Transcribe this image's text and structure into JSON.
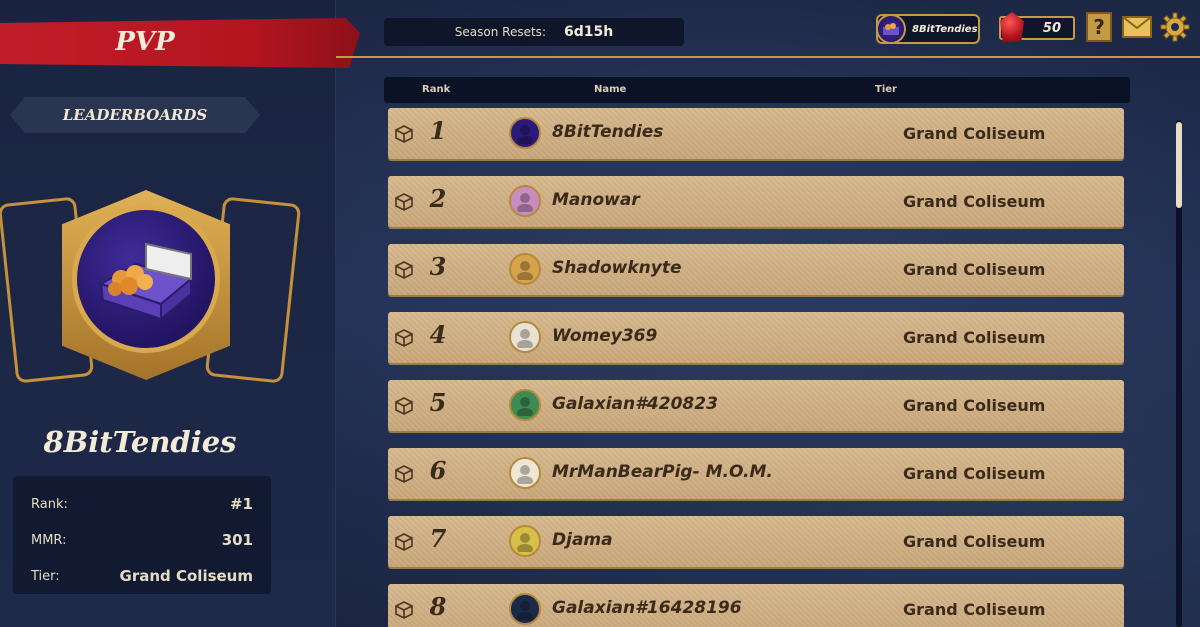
{
  "header": {
    "title": "PVP",
    "season_label": "Season Resets:",
    "season_value": "6d15h",
    "user_chip_name": "8BitTendies",
    "gems": "50",
    "help_label": "?"
  },
  "sidebar": {
    "tab_label": "LEADERBOARDS",
    "profile_name": "8BitTendies",
    "stats": [
      {
        "label": "Rank:",
        "value": "#1"
      },
      {
        "label": "MMR:",
        "value": "301"
      },
      {
        "label": "Tier:",
        "value": "Grand Coliseum"
      }
    ]
  },
  "table": {
    "headers": {
      "rank": "Rank",
      "name": "Name",
      "tier": "Tier"
    },
    "rows": [
      {
        "rank": "1",
        "name": "8BitTendies",
        "tier": "Grand Coliseum",
        "avatar": "tendies-box",
        "avatar_color": "#2b1a7a"
      },
      {
        "rank": "2",
        "name": "Manowar",
        "tier": "Grand Coliseum",
        "avatar": "ape",
        "avatar_color": "#c88cc0"
      },
      {
        "rank": "3",
        "name": "Shadowknyte",
        "tier": "Grand Coliseum",
        "avatar": "bear",
        "avatar_color": "#d6a24a"
      },
      {
        "rank": "4",
        "name": "Womey369",
        "tier": "Grand Coliseum",
        "avatar": "face",
        "avatar_color": "#e9e2d4"
      },
      {
        "rank": "5",
        "name": "Galaxian#420823",
        "tier": "Grand Coliseum",
        "avatar": "frog",
        "avatar_color": "#3d8a55"
      },
      {
        "rank": "6",
        "name": "MrManBearPig- M.O.M.",
        "tier": "Grand Coliseum",
        "avatar": "person",
        "avatar_color": "#efe6d6"
      },
      {
        "rank": "7",
        "name": "Djama",
        "tier": "Grand Coliseum",
        "avatar": "cartoon",
        "avatar_color": "#d7c04a"
      },
      {
        "rank": "8",
        "name": "Galaxian#16428196",
        "tier": "Grand Coliseum",
        "avatar": "silhouette",
        "avatar_color": "#1c2a4a"
      }
    ]
  },
  "colors": {
    "banner_red": "#c21d2a",
    "gold": "#c59a45",
    "row_parchment": "#d7b98e"
  }
}
